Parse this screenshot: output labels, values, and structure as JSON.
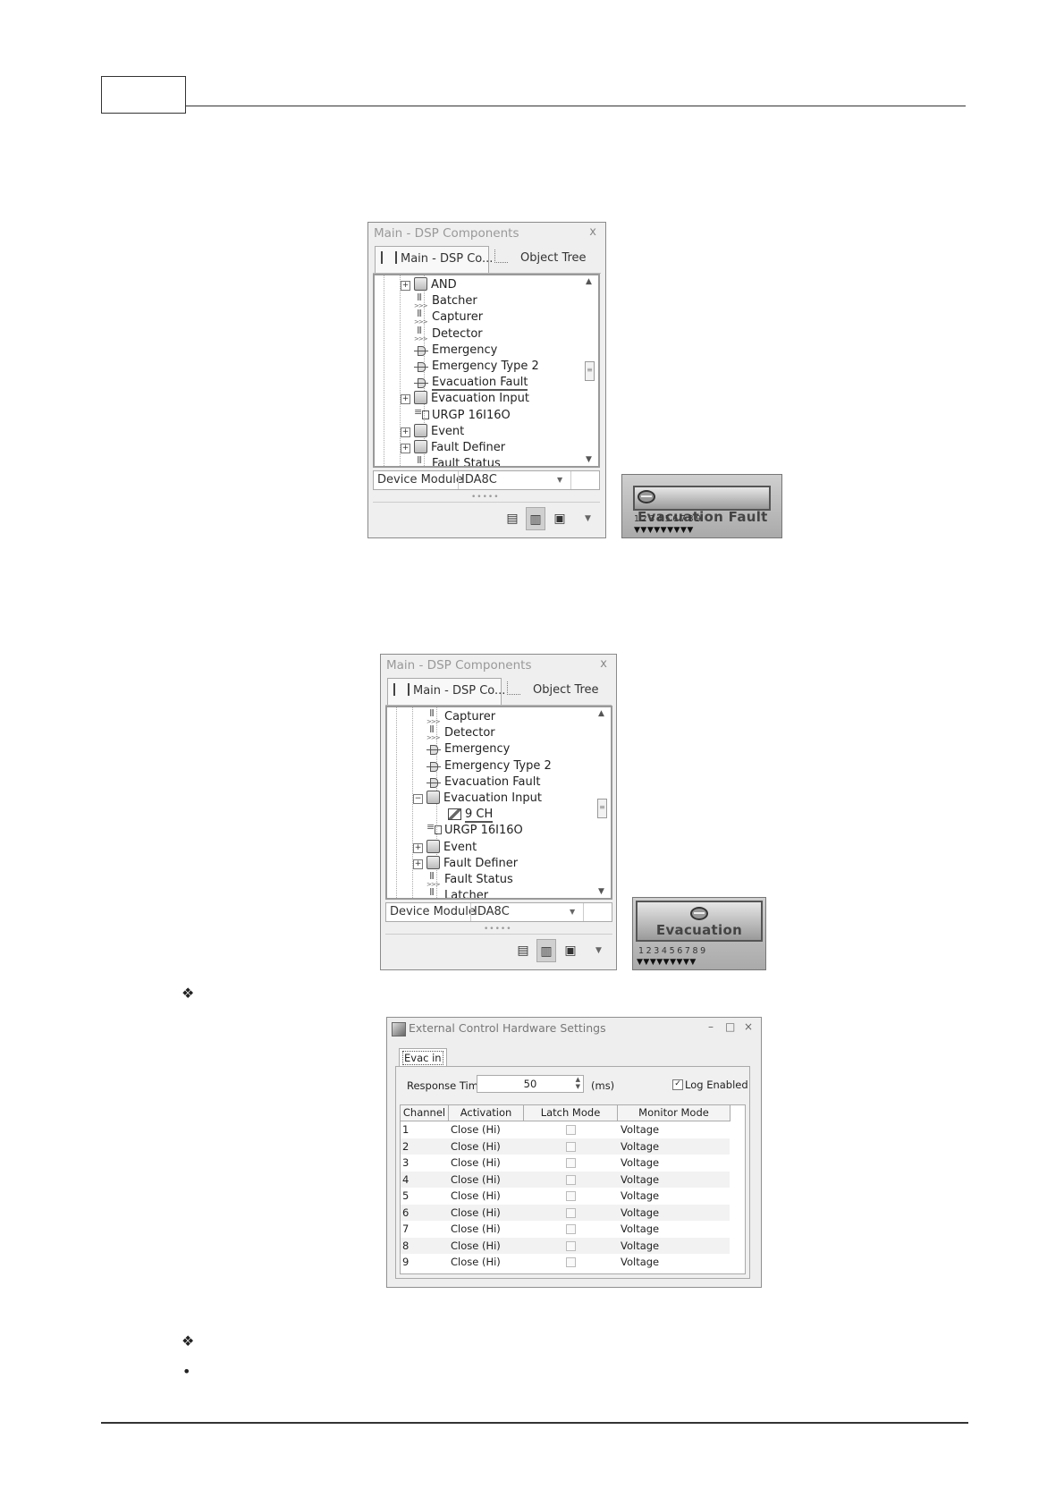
{
  "panel1": {
    "title": "Main - DSP Components",
    "close": "x",
    "tab_active": "Main - DSP Co...",
    "tab_other": "Object Tree",
    "tree": [
      {
        "label": "AND",
        "icon": "folder",
        "expand": "+",
        "level": 0
      },
      {
        "label": "Batcher",
        "icon": "component",
        "expand": "",
        "level": 0
      },
      {
        "label": "Capturer",
        "icon": "component",
        "expand": "",
        "level": 0
      },
      {
        "label": "Detector",
        "icon": "component",
        "expand": "",
        "level": 0
      },
      {
        "label": "Emergency",
        "icon": "port",
        "expand": "",
        "level": 0
      },
      {
        "label": "Emergency Type 2",
        "icon": "port",
        "expand": "",
        "level": 0
      },
      {
        "label": "Evacuation Fault",
        "icon": "port",
        "expand": "",
        "level": 0,
        "selected": true
      },
      {
        "label": "Evacuation Input",
        "icon": "folder",
        "expand": "+",
        "level": 0
      },
      {
        "label": "URGP 16I16O",
        "icon": "module",
        "expand": "",
        "level": 0
      },
      {
        "label": "Event",
        "icon": "folder",
        "expand": "+",
        "level": 0
      },
      {
        "label": "Fault Definer",
        "icon": "folder",
        "expand": "+",
        "level": 0
      },
      {
        "label": "Fault Status",
        "icon": "component",
        "expand": "",
        "level": 0
      }
    ],
    "device_module_label": "Device Module",
    "device_module_value": "IDA8C"
  },
  "panel2": {
    "title": "Main - DSP Components",
    "close": "x",
    "tab_active": "Main - DSP Co...",
    "tab_other": "Object Tree",
    "tree": [
      {
        "label": "Capturer",
        "icon": "component",
        "expand": "",
        "level": 0
      },
      {
        "label": "Detector",
        "icon": "component",
        "expand": "",
        "level": 0
      },
      {
        "label": "Emergency",
        "icon": "port",
        "expand": "",
        "level": 0
      },
      {
        "label": "Emergency Type 2",
        "icon": "port",
        "expand": "",
        "level": 0
      },
      {
        "label": "Evacuation Fault",
        "icon": "port",
        "expand": "",
        "level": 0
      },
      {
        "label": "Evacuation Input",
        "icon": "folder-open",
        "expand": "−",
        "level": 0
      },
      {
        "label": "9 CH",
        "icon": "9ch",
        "expand": "",
        "level": 1,
        "selected": true
      },
      {
        "label": "URGP 16I16O",
        "icon": "module",
        "expand": "",
        "level": 0
      },
      {
        "label": "Event",
        "icon": "folder",
        "expand": "+",
        "level": 0
      },
      {
        "label": "Fault Definer",
        "icon": "folder",
        "expand": "+",
        "level": 0
      },
      {
        "label": "Fault Status",
        "icon": "component",
        "expand": "",
        "level": 0
      },
      {
        "label": "Latcher",
        "icon": "component",
        "expand": "",
        "level": 0
      }
    ],
    "device_module_label": "Device Module",
    "device_module_value": "IDA8C"
  },
  "block1": {
    "label": "Evacuation Fault",
    "pins": "123456789"
  },
  "block2": {
    "label": "Evacuation",
    "pins": "123456789"
  },
  "dialog": {
    "title": "External Control Hardware Settings",
    "tab": "Evac in",
    "response_time_label": "Response Time",
    "response_time_value": "50",
    "response_time_unit": "(ms)",
    "log_enabled_label": "Log Enabled",
    "log_enabled": true,
    "columns": [
      "Channel",
      "Activation",
      "Latch Mode",
      "Monitor Mode"
    ],
    "rows": [
      {
        "channel": "1",
        "activation": "Close (Hi)",
        "latch": false,
        "monitor": "Voltage"
      },
      {
        "channel": "2",
        "activation": "Close (Hi)",
        "latch": false,
        "monitor": "Voltage"
      },
      {
        "channel": "3",
        "activation": "Close (Hi)",
        "latch": false,
        "monitor": "Voltage"
      },
      {
        "channel": "4",
        "activation": "Close (Hi)",
        "latch": false,
        "monitor": "Voltage"
      },
      {
        "channel": "5",
        "activation": "Close (Hi)",
        "latch": false,
        "monitor": "Voltage"
      },
      {
        "channel": "6",
        "activation": "Close (Hi)",
        "latch": false,
        "monitor": "Voltage"
      },
      {
        "channel": "7",
        "activation": "Close (Hi)",
        "latch": false,
        "monitor": "Voltage"
      },
      {
        "channel": "8",
        "activation": "Close (Hi)",
        "latch": false,
        "monitor": "Voltage"
      },
      {
        "channel": "9",
        "activation": "Close (Hi)",
        "latch": false,
        "monitor": "Voltage"
      }
    ]
  },
  "bullets": {
    "diamond": "❖",
    "dot": "•"
  }
}
